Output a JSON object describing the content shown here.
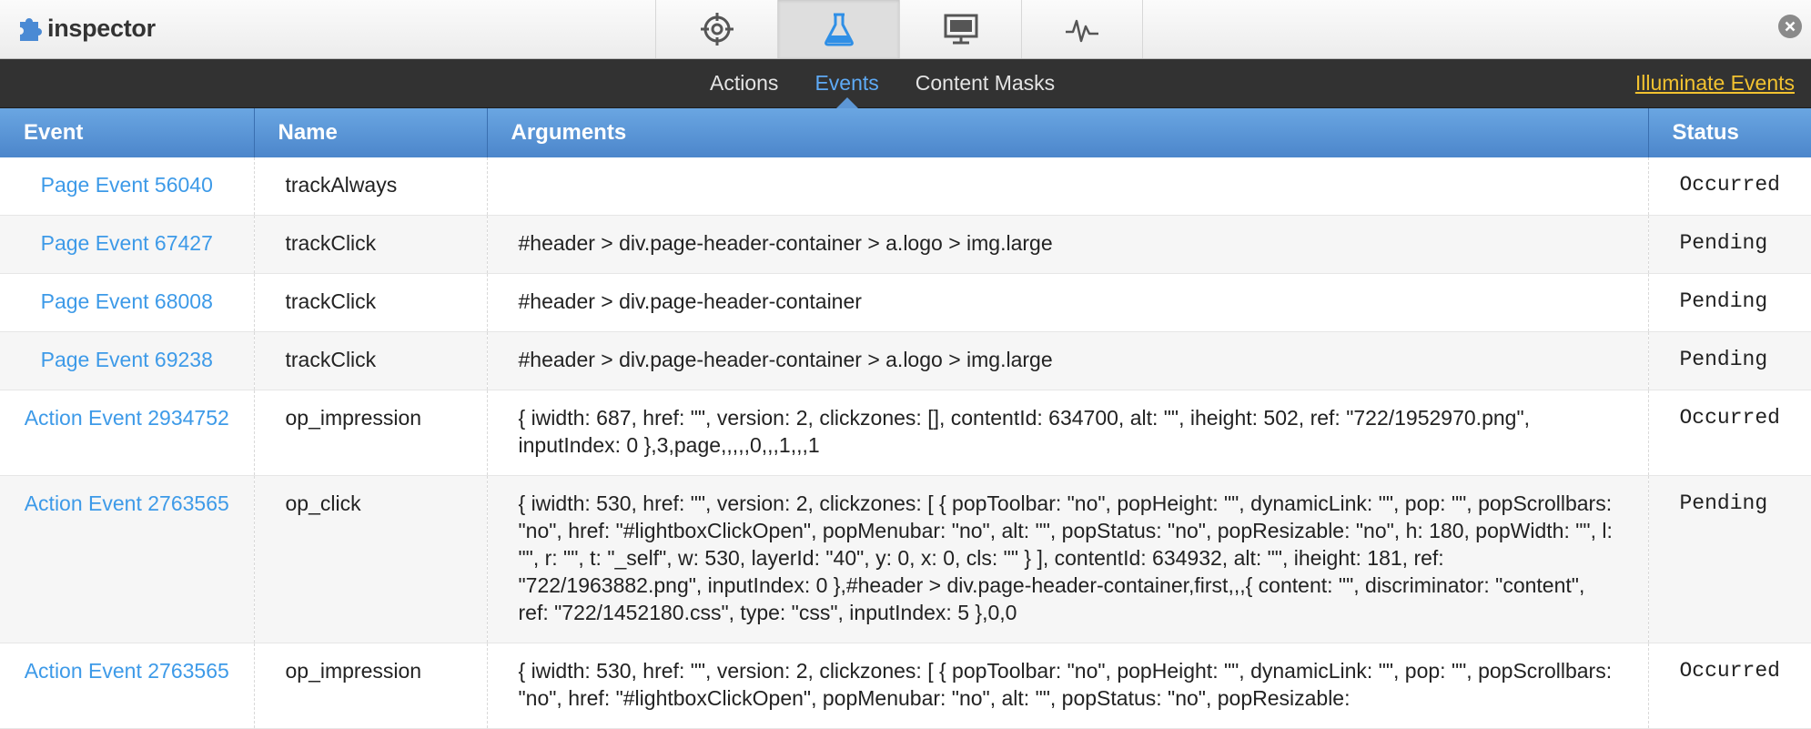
{
  "app": {
    "title": "inspector"
  },
  "toolbar": {
    "tabs": [
      {
        "icon": "crosshair-icon",
        "active": false
      },
      {
        "icon": "flask-icon",
        "active": true
      },
      {
        "icon": "monitor-icon",
        "active": false
      },
      {
        "icon": "pulse-icon",
        "active": false
      }
    ]
  },
  "subnav": {
    "tabs": [
      "Actions",
      "Events",
      "Content Masks"
    ],
    "active_tab": "Events",
    "illuminate_label": "Illuminate Events"
  },
  "table": {
    "headers": {
      "event": "Event",
      "name": "Name",
      "arguments": "Arguments",
      "status": "Status"
    },
    "rows": [
      {
        "event": "Page Event 56040",
        "name": "trackAlways",
        "args": "",
        "status": "Occurred"
      },
      {
        "event": "Page Event 67427",
        "name": "trackClick",
        "args": "#header > div.page-header-container > a.logo > img.large",
        "status": "Pending"
      },
      {
        "event": "Page Event 68008",
        "name": "trackClick",
        "args": "#header > div.page-header-container",
        "status": "Pending"
      },
      {
        "event": "Page Event 69238",
        "name": "trackClick",
        "args": "#header > div.page-header-container > a.logo > img.large",
        "status": "Pending"
      },
      {
        "event": "Action Event 2934752",
        "name": "op_impression",
        "args": "{ iwidth: 687, href: \"\", version: 2, clickzones: [], contentId: 634700, alt: \"\", iheight: 502, ref: \"722/1952970.png\", inputIndex: 0 },3,page,,,,,0,,,1,,,1",
        "status": "Occurred"
      },
      {
        "event": "Action Event 2763565",
        "name": "op_click",
        "args": "{ iwidth: 530, href: \"\", version: 2, clickzones: [ { popToolbar: \"no\", popHeight: \"\", dynamicLink: \"\", pop: \"\", popScrollbars: \"no\", href: \"#lightboxClickOpen\", popMenubar: \"no\", alt: \"\", popStatus: \"no\", popResizable: \"no\", h: 180, popWidth: \"\", l: \"\", r: \"\", t: \"_self\", w: 530, layerId: \"40\", y: 0, x: 0, cls: \"\" } ], contentId: 634932, alt: \"\", iheight: 181, ref: \"722/1963882.png\", inputIndex: 0 },#header > div.page-header-container,first,,,{ content: \"\", discriminator: \"content\", ref: \"722/1452180.css\", type: \"css\", inputIndex: 5 },0,0",
        "status": "Pending"
      },
      {
        "event": "Action Event 2763565",
        "name": "op_impression",
        "args": "{ iwidth: 530, href: \"\", version: 2, clickzones: [ { popToolbar: \"no\", popHeight: \"\", dynamicLink: \"\", pop: \"\", popScrollbars: \"no\", href: \"#lightboxClickOpen\", popMenubar: \"no\", alt: \"\", popStatus: \"no\", popResizable:",
        "status": "Occurred"
      }
    ]
  },
  "colors": {
    "accent_blue": "#3d9ae8",
    "header_blue": "#5b96d8",
    "dark_bar": "#323232",
    "illuminate_yellow": "#f2c230"
  }
}
